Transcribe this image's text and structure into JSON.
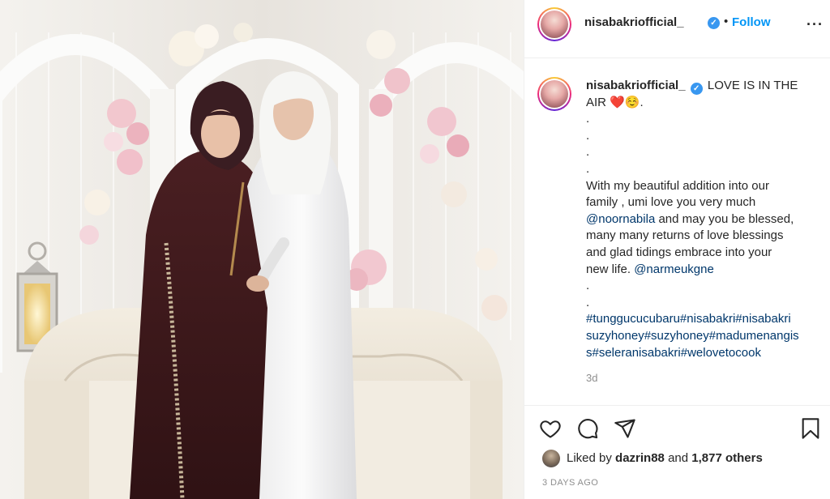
{
  "post": {
    "author": "nisabakriofficial_",
    "follow_label": "Follow",
    "separator": "•",
    "more_label": "···",
    "verified_mark": "✓",
    "caption_lines": [
      {
        "type": "first",
        "text": "LOVE IS IN THE"
      },
      {
        "type": "text",
        "text": "AIR ❤️☺️."
      },
      {
        "type": "text",
        "text": "."
      },
      {
        "type": "text",
        "text": "."
      },
      {
        "type": "text",
        "text": "."
      },
      {
        "type": "text",
        "text": "."
      },
      {
        "type": "text",
        "text": "With my beautiful addition into our"
      },
      {
        "type": "text",
        "text": "family , umi love you very much"
      },
      {
        "type": "mixed",
        "link": "@noornabila",
        "text": " and may you be blessed,"
      },
      {
        "type": "text",
        "text": "many many returns of love blessings"
      },
      {
        "type": "text",
        "text": "and glad tidings embrace into your"
      },
      {
        "type": "mixed_end",
        "text": "new life. ",
        "link": "@narmeukgne"
      },
      {
        "type": "text",
        "text": "."
      },
      {
        "type": "text",
        "text": "."
      },
      {
        "type": "link",
        "text": "#tunggucucubaru#nisabakri#nisabakri"
      },
      {
        "type": "link",
        "text": "suzyhoney#suzyhoney#madumenangis"
      },
      {
        "type": "link",
        "text": "s#seleranisabakri#welovetocook"
      }
    ],
    "relative_time": "3d",
    "liked_by_prefix": "Liked by ",
    "liked_by_user": "dazrin88",
    "liked_by_middle": " and ",
    "liked_by_count": "1,877 others",
    "posted_ago": "3 DAYS AGO"
  },
  "icons": {
    "heart": "heart-icon",
    "comment": "comment-icon",
    "share": "share-icon",
    "save": "bookmark-icon",
    "verified": "verified-badge-icon"
  },
  "colors": {
    "follow": "#0095f6",
    "verified": "#3897f0",
    "link": "#00376b",
    "muted": "#8e8e8e"
  }
}
